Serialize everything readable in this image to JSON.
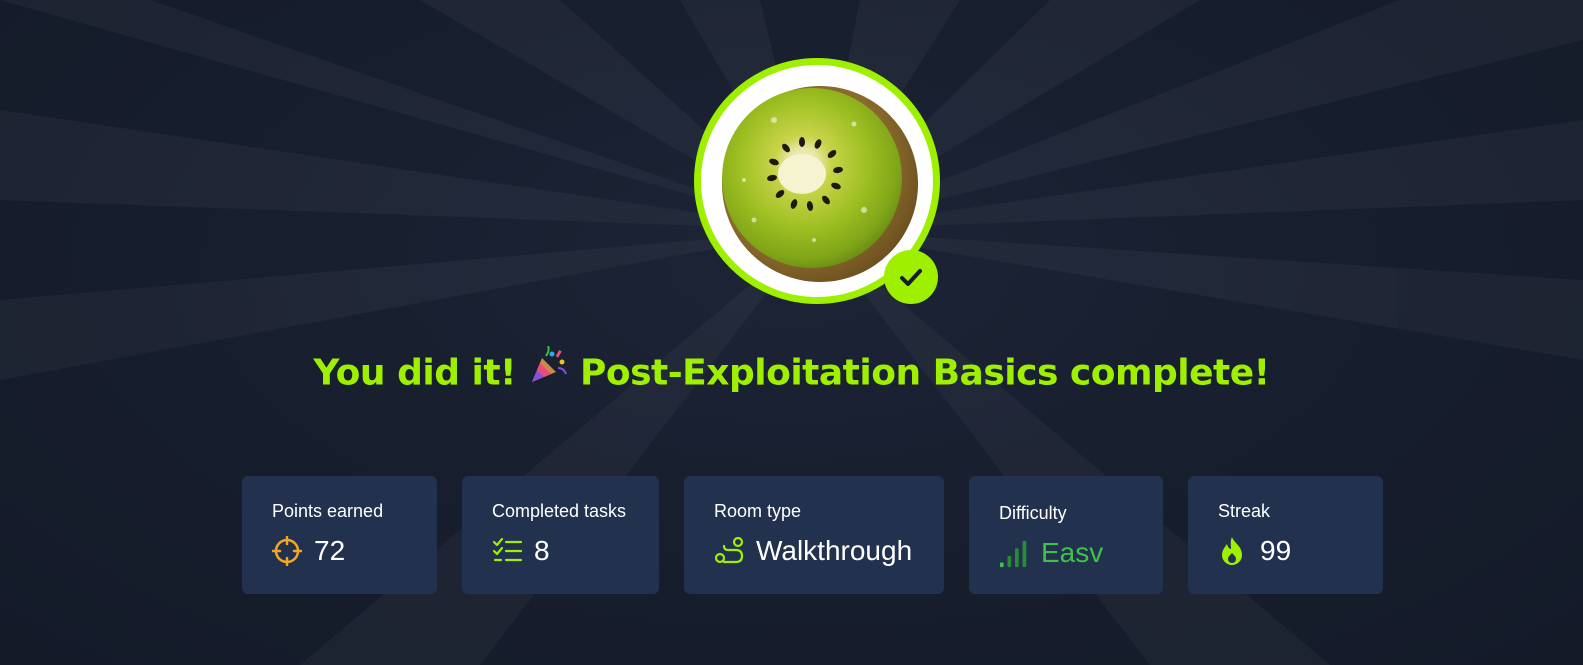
{
  "completion": {
    "title_prefix": "You did it!",
    "title_suffix": "Post-Exploitation Basics complete!",
    "badge_image": "kiwi-slice",
    "accent_color": "#9fef00"
  },
  "stats": {
    "points": {
      "label": "Points earned",
      "value": "72",
      "icon": "crosshair-icon"
    },
    "tasks": {
      "label": "Completed tasks",
      "value": "8",
      "icon": "checklist-icon"
    },
    "room_type": {
      "label": "Room type",
      "value": "Walkthrough",
      "icon": "path-icon"
    },
    "difficulty": {
      "label": "Difficulty",
      "value": "Easv",
      "icon": "signal-bars-icon",
      "color": "#3ec24b"
    },
    "streak": {
      "label": "Streak",
      "value": "99",
      "icon": "flame-icon"
    }
  }
}
